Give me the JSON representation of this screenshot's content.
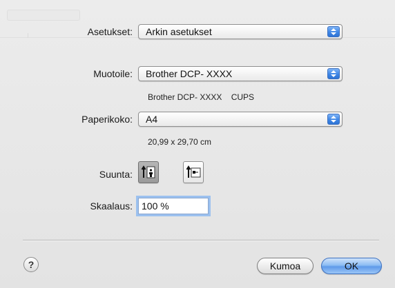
{
  "dialog": {
    "settings_label": "Asetukset:",
    "settings_value": "Arkin asetukset",
    "format_label": "Muotoile:",
    "format_value": "Brother DCP- XXXX",
    "format_sub": "Brother DCP- XXXX    CUPS",
    "paper_label": "Paperikoko:",
    "paper_value": "A4",
    "paper_sub": "20,99 x 29,70 cm",
    "orientation_label": "Suunta:",
    "scale_label": "Skaalaus:",
    "scale_value": "100 %",
    "help_label": "?",
    "cancel_label": "Kumoa",
    "ok_label": "OK"
  },
  "icons": {
    "popup_arrows": "up-down-arrows-icon",
    "portrait": "portrait-orientation-icon",
    "landscape": "landscape-orientation-icon",
    "help": "help-icon"
  },
  "colors": {
    "accent_blue": "#3e86e6",
    "focus_ring": "#9cc1ef",
    "background": "#e8e8e8"
  }
}
